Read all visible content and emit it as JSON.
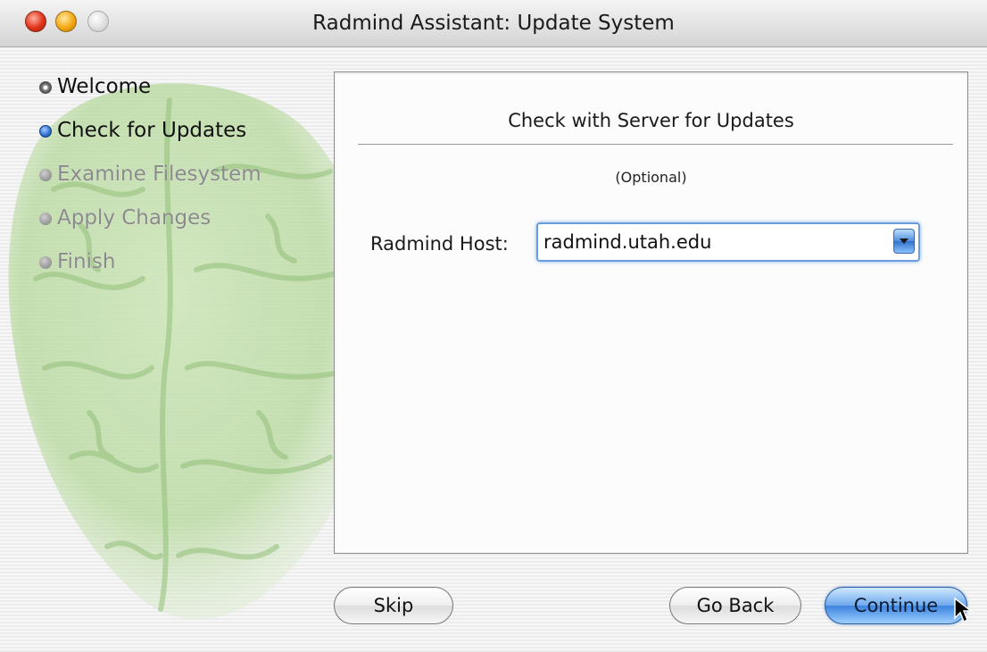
{
  "window": {
    "title": "Radmind Assistant: Update System"
  },
  "steps": [
    {
      "label": "Welcome",
      "state": "done"
    },
    {
      "label": "Check for Updates",
      "state": "current"
    },
    {
      "label": "Examine Filesystem",
      "state": "pending"
    },
    {
      "label": "Apply Changes",
      "state": "pending"
    },
    {
      "label": "Finish",
      "state": "pending"
    }
  ],
  "panel": {
    "heading": "Check with Server for Updates",
    "subtitle": "(Optional)",
    "host_label": "Radmind Host:",
    "host_value": "radmind.utah.edu"
  },
  "buttons": {
    "skip": "Skip",
    "back": "Go Back",
    "continue": "Continue"
  },
  "colors": {
    "accent": "#3b82dd",
    "brain": "#a8d08c"
  }
}
